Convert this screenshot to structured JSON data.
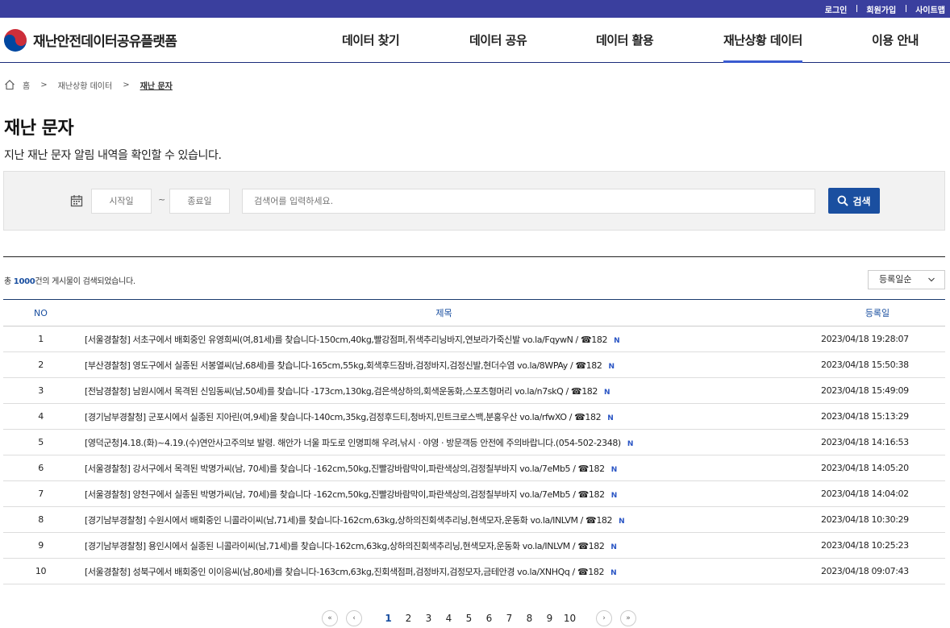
{
  "topbar": {
    "login": "로그인",
    "signup": "회원가입",
    "sitemap": "사이트맵"
  },
  "logo": {
    "text": "재난안전데이터공유플랫폼"
  },
  "nav": [
    "데이터 찾기",
    "데이터 공유",
    "데이터 활용",
    "재난상황 데이터",
    "이용 안내"
  ],
  "breadcrumb": {
    "home": "홈",
    "level1": "재난상황 데이터",
    "current": "재난 문자"
  },
  "page": {
    "title": "재난 문자",
    "desc": "지난 재난 문자 알림 내역을 확인할 수 있습니다."
  },
  "search": {
    "start_placeholder": "시작일",
    "tilde": "~",
    "end_placeholder": "종료일",
    "keyword_placeholder": "검색어를 입력하세요.",
    "button": "검색"
  },
  "result": {
    "prefix": "총 ",
    "count": "1000",
    "suffix": "건의 게시물이 검색되었습니다."
  },
  "sort": {
    "selected": "등록일순"
  },
  "table": {
    "headers": {
      "no": "NO",
      "title": "제목",
      "date": "등록일"
    },
    "new_badge": "N",
    "rows": [
      {
        "no": "1",
        "title": "[서울경찰청] 서초구에서 배회중인 유영희씨(여,81세)를 찾습니다-150cm,40kg,빨강점퍼,쥐색추리닝바지,연보라가죽신발 vo.la/FqywN / ☎182",
        "date": "2023/04/18 19:28:07"
      },
      {
        "no": "2",
        "title": "[부산경찰청] 영도구에서 실종된 서봉열씨(남,68세)를 찾습니다-165cm,55kg,회색후드잠바,검정바지,검정신발,현더수염 vo.la/8WPAy / ☎182",
        "date": "2023/04/18 15:50:38"
      },
      {
        "no": "3",
        "title": "[전남경찰청] 남원시에서 목격된 신임동씨(남,50세)를 찾습니다 -173cm,130kg,검은색상하의,회색운동화,스포츠형머리 vo.la/n7skQ / ☎182",
        "date": "2023/04/18 15:49:09"
      },
      {
        "no": "4",
        "title": "[경기남부경찰청] 군포시에서 실종된 지아린(여,9세)을 찾습니다-140cm,35kg,검정후드티,청바지,민트크로스백,분홍우산 vo.la/rfwXO / ☎182",
        "date": "2023/04/18 15:13:29"
      },
      {
        "no": "5",
        "title": "[영덕군청]4.18.(화)~4.19.(수)연안사고주의보 발령. 해안가 너울 파도로 인명피해 우려,낚시 · 야영 · 방문객등 안전에 주의바랍니다.(054-502-2348)",
        "date": "2023/04/18 14:16:53"
      },
      {
        "no": "6",
        "title": "[서울경찰청] 강서구에서 목격된 박명가씨(남, 70세)를 찾습니다 -162cm,50kg,진빨강바람막이,파란색상의,검정칠부바지 vo.la/7eMb5 / ☎182",
        "date": "2023/04/18 14:05:20"
      },
      {
        "no": "7",
        "title": "[서울경찰청] 양천구에서 실종된 박명가씨(남, 70세)를 찾습니다 -162cm,50kg,진빨강바람막이,파란색상의,검정칠부바지 vo.la/7eMb5 / ☎182",
        "date": "2023/04/18 14:04:02"
      },
      {
        "no": "8",
        "title": "[경기남부경찰청] 수원시에서 배회중인 니콜라이씨(남,71세)를 찾습니다-162cm,63kg,상하의진회색추리닝,현색모자,운동화 vo.la/INLVM / ☎182",
        "date": "2023/04/18 10:30:29"
      },
      {
        "no": "9",
        "title": "[경기남부경찰청] 용인시에서 실종된 니콜라이씨(남,71세)를 찾습니다-162cm,63kg,상하의진회색추리닝,현색모자,운동화 vo.la/INLVM / ☎182",
        "date": "2023/04/18 10:25:23"
      },
      {
        "no": "10",
        "title": "[서울경찰청] 성북구에서 배회중인 이이응씨(남,80세)를 찾습니다-163cm,63kg,진회색점퍼,검정바지,검정모자,금테안경 vo.la/XNHQq / ☎182",
        "date": "2023/04/18 09:07:43"
      }
    ]
  },
  "pagination": {
    "pages": [
      "1",
      "2",
      "3",
      "4",
      "5",
      "6",
      "7",
      "8",
      "9",
      "10"
    ],
    "current": "1"
  },
  "colors": {
    "topbar": "#3a3f9e",
    "accent": "#1a4fa0",
    "new_badge": "#2a55c4"
  }
}
